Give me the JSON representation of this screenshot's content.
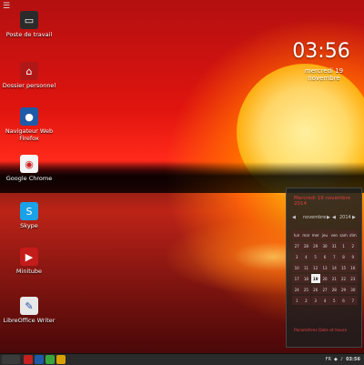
{
  "desktop": {
    "icons": [
      {
        "label": "Poste de travail",
        "icon": "computer-icon",
        "color": "#2b2b2b"
      },
      {
        "label": "Dossier personnel",
        "icon": "home-folder-icon",
        "color": "#b01818"
      },
      {
        "label": "Navigateur Web Firefox",
        "icon": "firefox-icon",
        "color": "#1f5aa8"
      },
      {
        "label": "Google Chrome",
        "icon": "chrome-icon",
        "color": "#f5f5f5"
      },
      {
        "label": "Skype",
        "icon": "skype-icon",
        "color": "#1aa1e6"
      },
      {
        "label": "Minitube",
        "icon": "minitube-icon",
        "color": "#c41b1b"
      },
      {
        "label": "LibreOffice Writer",
        "icon": "writer-icon",
        "color": "#e8e8e8"
      }
    ]
  },
  "clock": {
    "time": "03:56",
    "date": "mercredi 19 novembre"
  },
  "calendar": {
    "title": "Mercredi 19 novembre 2014",
    "month": "novembre",
    "year": "2014",
    "weekdays": [
      "lun",
      "mar",
      "mer",
      "jeu",
      "ven",
      "sam",
      "dim"
    ],
    "rows": [
      [
        "27",
        "28",
        "29",
        "30",
        "31",
        "1",
        "2"
      ],
      [
        "3",
        "4",
        "5",
        "6",
        "7",
        "8",
        "9"
      ],
      [
        "10",
        "11",
        "12",
        "13",
        "14",
        "15",
        "16"
      ],
      [
        "17",
        "18",
        "19",
        "20",
        "21",
        "22",
        "23"
      ],
      [
        "24",
        "25",
        "26",
        "27",
        "28",
        "29",
        "30"
      ],
      [
        "1",
        "2",
        "3",
        "4",
        "5",
        "6",
        "7"
      ]
    ],
    "today": "19",
    "link": "Paramètres Date et heure"
  },
  "taskbar": {
    "time": "03:56",
    "tray_text": "FR"
  }
}
